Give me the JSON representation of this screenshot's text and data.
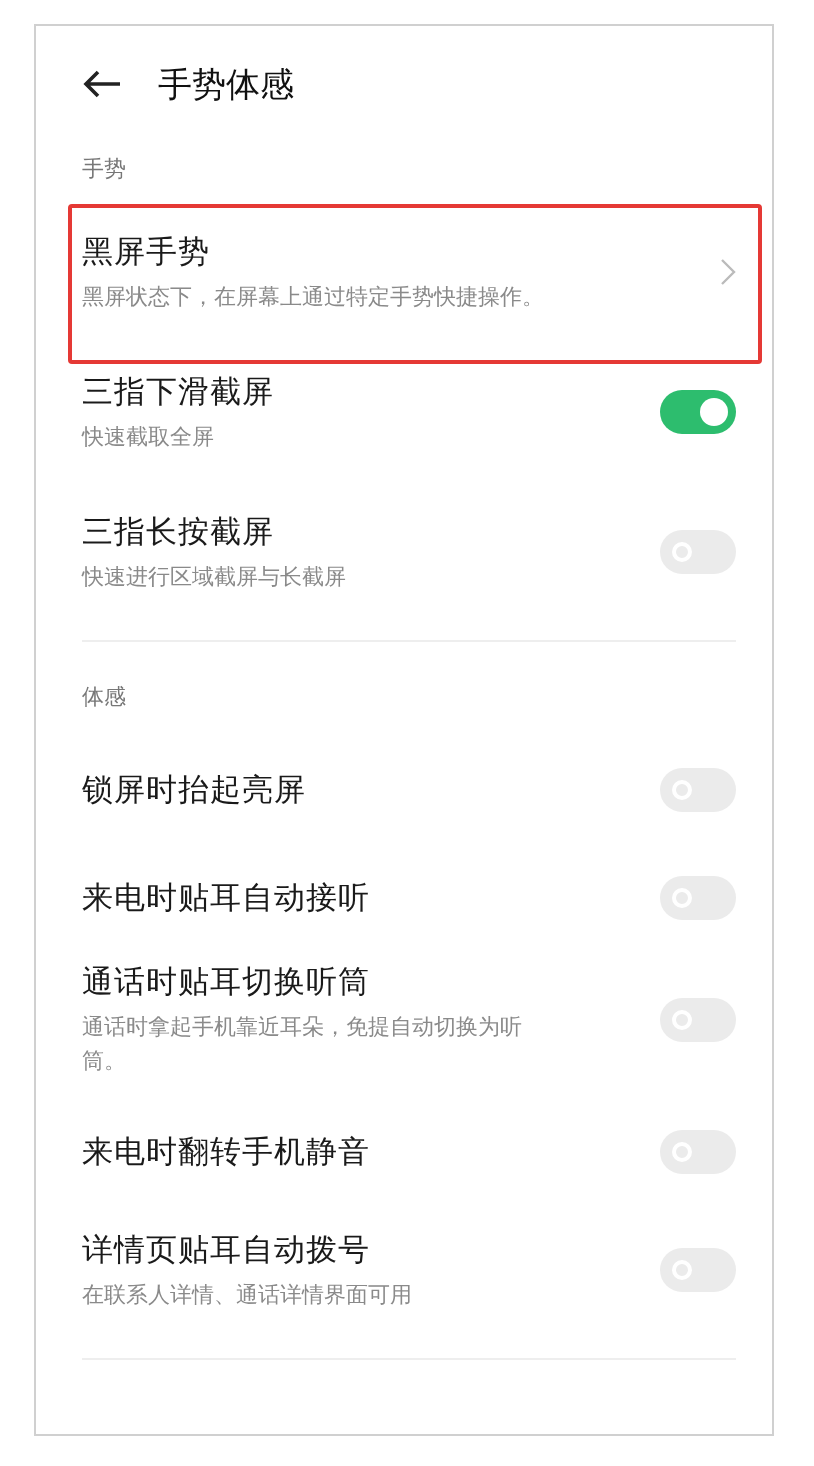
{
  "header": {
    "title": "手势体感"
  },
  "sections": [
    {
      "label": "手势",
      "items": [
        {
          "kind": "link",
          "title": "黑屏手势",
          "subtitle": "黑屏状态下，在屏幕上通过特定手势快捷操作。",
          "highlighted": true
        },
        {
          "kind": "toggle",
          "title": "三指下滑截屏",
          "subtitle": "快速截取全屏",
          "on": true
        },
        {
          "kind": "toggle",
          "title": "三指长按截屏",
          "subtitle": "快速进行区域截屏与长截屏",
          "on": false
        }
      ]
    },
    {
      "label": "体感",
      "items": [
        {
          "kind": "toggle",
          "title": "锁屏时抬起亮屏",
          "on": false
        },
        {
          "kind": "toggle",
          "title": "来电时贴耳自动接听",
          "on": false
        },
        {
          "kind": "toggle",
          "title": "通话时贴耳切换听筒",
          "subtitle": "通话时拿起手机靠近耳朵，免提自动切换为听筒。",
          "on": false
        },
        {
          "kind": "toggle",
          "title": "来电时翻转手机静音",
          "on": false
        },
        {
          "kind": "toggle",
          "title": "详情页贴耳自动拨号",
          "subtitle": "在联系人详情、通话详情界面可用",
          "on": false
        }
      ]
    }
  ]
}
